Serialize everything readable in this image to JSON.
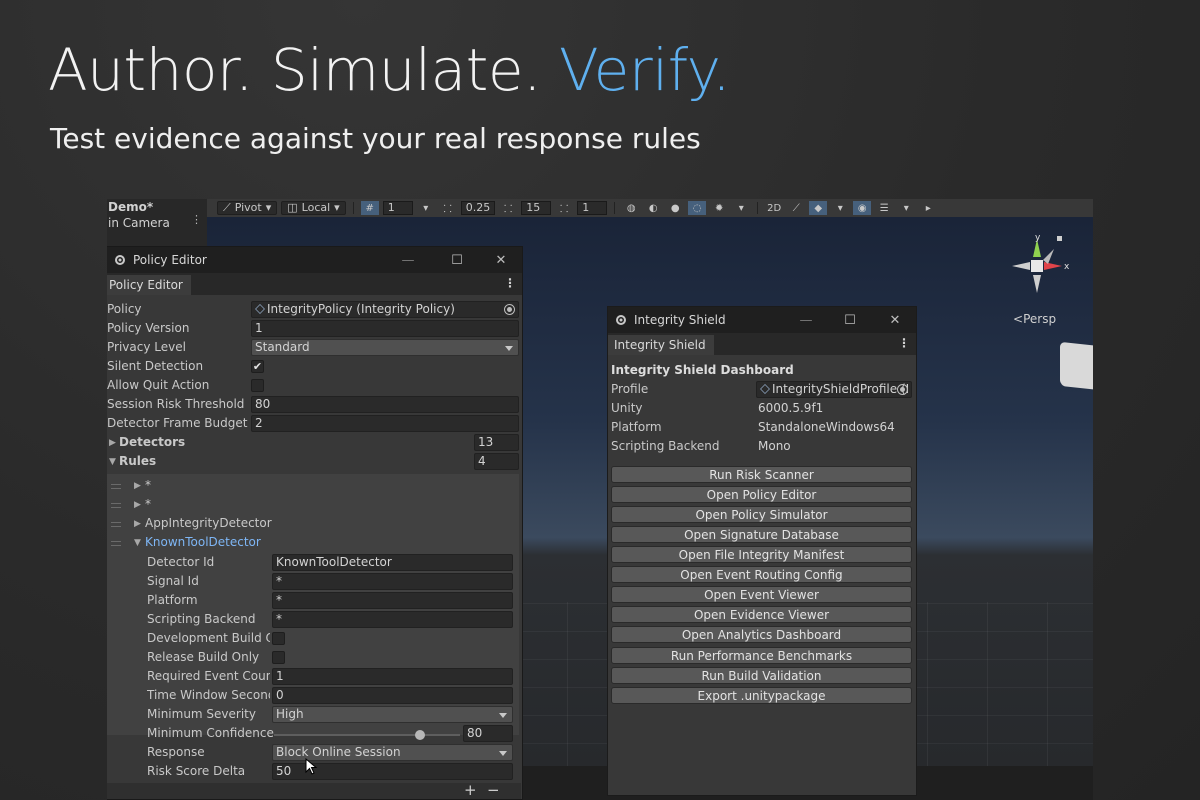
{
  "headline": {
    "part1": "Author. Simulate.",
    "accent": "Verify."
  },
  "subhead": "Test evidence against your real response rules",
  "colors": {
    "accent": "#5fb0ef",
    "selected": "#7eb6f5"
  },
  "toolbar": {
    "pivot": "Pivot",
    "local": "Local",
    "grid_value": "1",
    "snap_value": "0.25",
    "rotate_value": "15",
    "scale_value": "1"
  },
  "hierarchy": {
    "scene_name": "Demo*",
    "item": "in Camera"
  },
  "policy_editor": {
    "title": "Policy Editor",
    "tab": "Policy Editor",
    "fields": {
      "policy_label": "Policy",
      "policy_value": "IntegrityPolicy (Integrity Policy)",
      "version_label": "Policy Version",
      "version_value": "1",
      "privacy_label": "Privacy Level",
      "privacy_value": "Standard",
      "silent_label": "Silent Detection",
      "silent_checked": "✔",
      "quit_label": "Allow Quit Action",
      "threshold_label": "Session Risk Threshold",
      "threshold_value": "80",
      "budget_label": "Detector Frame Budget Ms",
      "budget_value": "2",
      "detectors_label": "Detectors",
      "detectors_count": "13",
      "rules_label": "Rules",
      "rules_count": "4"
    },
    "rules": [
      {
        "label": "*"
      },
      {
        "label": "*"
      },
      {
        "label": "AppIntegrityDetector"
      },
      {
        "label": "KnownToolDetector"
      }
    ],
    "rule_detail": {
      "detector_id_label": "Detector Id",
      "detector_id_value": "KnownToolDetector",
      "signal_id_label": "Signal Id",
      "signal_id_value": "*",
      "platform_label": "Platform",
      "platform_value": "*",
      "backend_label": "Scripting Backend",
      "backend_value": "*",
      "dev_only_label": "Development Build Only",
      "release_only_label": "Release Build Only",
      "event_count_label": "Required Event Count",
      "event_count_value": "1",
      "window_label": "Time Window Seconds",
      "window_value": "0",
      "severity_label": "Minimum Severity",
      "severity_value": "High",
      "confidence_label": "Minimum Confidence",
      "confidence_value": "80",
      "confidence_fraction": 0.8,
      "response_label": "Response",
      "response_value": "Block Online Session",
      "risk_delta_label": "Risk Score Delta",
      "risk_delta_value": "50"
    },
    "footer": {
      "add": "+",
      "remove": "−"
    }
  },
  "integrity_shield": {
    "title": "Integrity Shield",
    "tab": "Integrity Shield",
    "heading": "Integrity Shield Dashboard",
    "info": [
      {
        "label": "Profile",
        "value": "IntegrityShieldProfile (I"
      },
      {
        "label": "Unity",
        "value": "6000.5.9f1"
      },
      {
        "label": "Platform",
        "value": "StandaloneWindows64"
      },
      {
        "label": "Scripting Backend",
        "value": "Mono"
      }
    ],
    "buttons": [
      "Run Risk Scanner",
      "Open Policy Editor",
      "Open Policy Simulator",
      "Open Signature Database",
      "Open File Integrity Manifest",
      "Open Event Routing Config",
      "Open Event Viewer",
      "Open Evidence Viewer",
      "Open Analytics Dashboard",
      "Run Performance Benchmarks",
      "Run Build Validation",
      "Export .unitypackage"
    ]
  },
  "scene_view": {
    "persp_label": "Persp",
    "axis_x": "x",
    "axis_y": "y"
  }
}
